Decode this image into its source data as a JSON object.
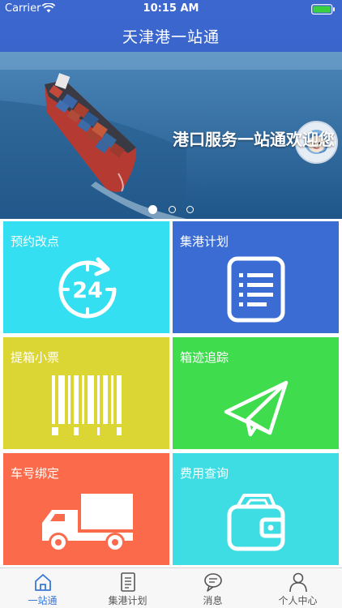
{
  "status_bar": {
    "carrier": "Carrier",
    "time": "10:15 AM"
  },
  "nav": {
    "title": "天津港一站通"
  },
  "banner": {
    "welcome": "港口服务一站通欢迎您",
    "slides_total": 3,
    "active_slide": 1
  },
  "tiles": [
    {
      "label": "预约改点",
      "color": "#33dff0",
      "icon": "clock-24-icon"
    },
    {
      "label": "集港计划",
      "color": "#3b6cd4",
      "icon": "list-document-icon"
    },
    {
      "label": "提箱小票",
      "color": "#dcd635",
      "icon": "barcode-icon"
    },
    {
      "label": "箱迹追踪",
      "color": "#3fdc4e",
      "icon": "paper-plane-icon"
    },
    {
      "label": "车号绑定",
      "color": "#fb6a4a",
      "icon": "truck-icon"
    },
    {
      "label": "费用查询",
      "color": "#3edde3",
      "icon": "wallet-icon"
    }
  ],
  "tabbar": {
    "items": [
      {
        "label": "一站通",
        "icon": "home-icon",
        "active": true
      },
      {
        "label": "集港计划",
        "icon": "document-icon",
        "active": false
      },
      {
        "label": "消息",
        "icon": "chat-bubble-icon",
        "active": false
      },
      {
        "label": "个人中心",
        "icon": "person-icon",
        "active": false
      }
    ]
  },
  "colors": {
    "nav": "#3a66cc",
    "tab_active": "#3a78d8"
  }
}
